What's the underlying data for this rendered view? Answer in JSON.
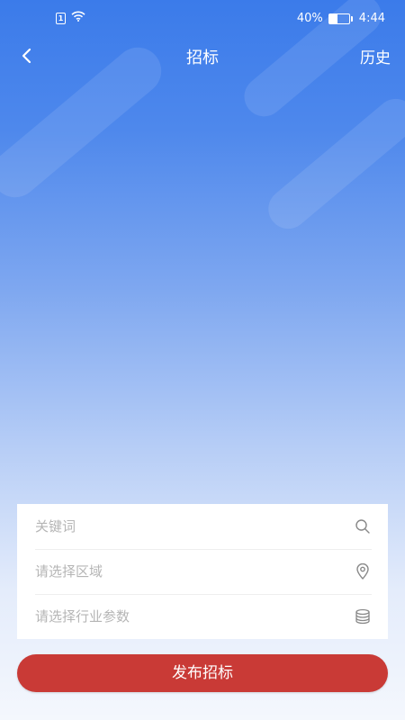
{
  "status_bar": {
    "sim_badge": "1",
    "battery_percent": "40%",
    "battery_level": 0.4,
    "time": "4:44"
  },
  "nav": {
    "title": "招标",
    "history_label": "历史"
  },
  "form": {
    "keyword_placeholder": "关键词",
    "region_placeholder": "请选择区域",
    "industry_placeholder": "请选择行业参数"
  },
  "actions": {
    "submit_label": "发布招标"
  },
  "icons": {
    "back": "chevron-left-icon",
    "search": "search-icon",
    "location": "map-pin-icon",
    "industry": "database-icon",
    "wifi": "wifi-icon",
    "battery": "battery-icon"
  },
  "colors": {
    "header_blue": "#3b7bea",
    "submit_red": "#c93a36"
  }
}
